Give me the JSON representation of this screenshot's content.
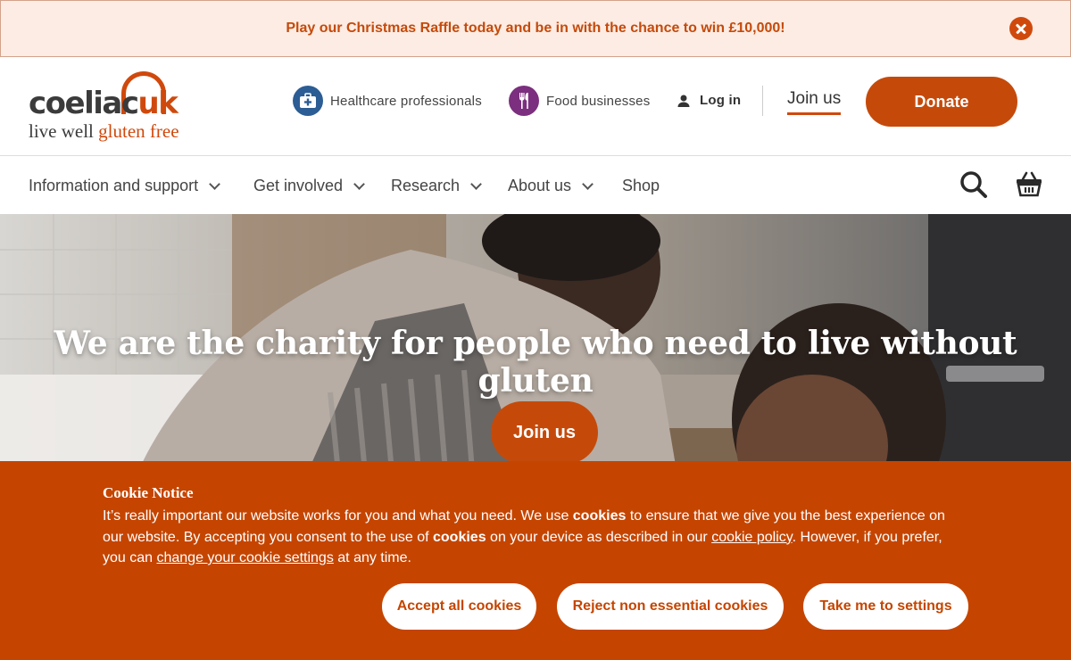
{
  "raffle": {
    "text": "Play our Christmas Raffle today and be in with the chance to win £10,000!"
  },
  "logo": {
    "name_a": "coeliac",
    "name_b": "uk",
    "tagline_a": "live well ",
    "tagline_b": "gluten free"
  },
  "utility": {
    "healthcare": "Healthcare professionals",
    "food": "Food businesses",
    "login": "Log in",
    "join": "Join us",
    "donate": "Donate"
  },
  "nav": {
    "items": [
      {
        "label": "Information and support"
      },
      {
        "label": "Get involved"
      },
      {
        "label": "Research"
      },
      {
        "label": "About us"
      },
      {
        "label": "Shop"
      }
    ]
  },
  "hero": {
    "title": "We are the charity for people who need to live without gluten",
    "cta": "Join us"
  },
  "cookie": {
    "title": "Cookie Notice",
    "p1": "It’s really important our website works for you and what you need. We use ",
    "b1": "cookies",
    "p2": " to ensure that we give you the best experience on our website. By accepting you consent to the use of ",
    "b2": "cookies",
    "p3": " on your device as described in our ",
    "link1": "cookie policy",
    "p4": ". However, if you prefer, you can ",
    "link2": "change your cookie settings",
    "p5": " at any time.",
    "accept": "Accept all cookies",
    "reject": "Reject non essential cookies",
    "settings": "Take me to settings"
  },
  "colors": {
    "brand_orange": "#c54a0a",
    "healthcare_blue": "#2c5d94",
    "food_purple": "#7b2f7e",
    "banner_bg": "#fcece4"
  }
}
